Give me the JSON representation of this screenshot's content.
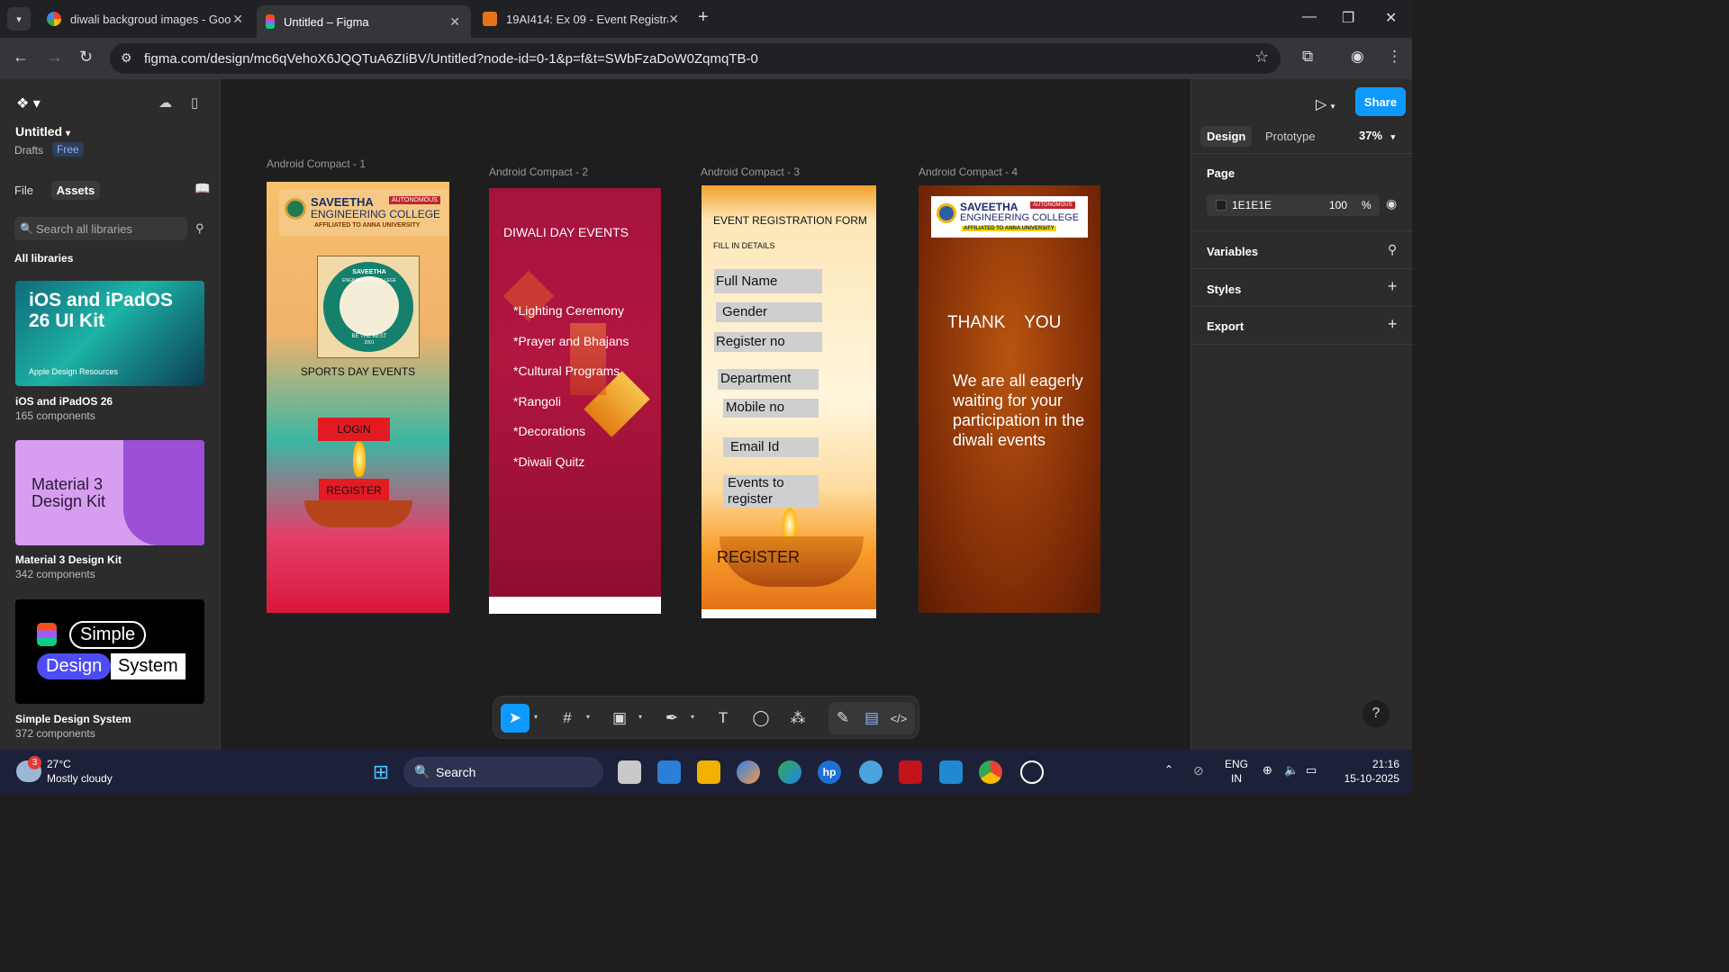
{
  "browser": {
    "tabs": [
      {
        "title": "diwali backgroud images - Goo",
        "active": false
      },
      {
        "title": "Untitled – Figma",
        "active": true
      },
      {
        "title": "19AI414: Ex 09 - Event Registrat",
        "active": false
      }
    ],
    "url": "figma.com/design/mc6qVehoX6JQQTuA6ZIiBV/Untitled?node-id=0-1&p=f&t=SWbFzaDoW0ZqmqTB-0"
  },
  "left_panel": {
    "file_title": "Untitled",
    "location": "Drafts",
    "plan_badge": "Free",
    "tabs": [
      "File",
      "Assets"
    ],
    "search_placeholder": "Search all libraries",
    "section_title": "All libraries",
    "libraries": [
      {
        "thumb_title": "iOS and iPadOS 26 UI Kit",
        "thumb_sub": "Apple Design Resources",
        "name": "iOS and iPadOS 26",
        "count": "165 components"
      },
      {
        "thumb_title": "Material 3 Design Kit",
        "name": "Material 3 Design Kit",
        "count": "342 components"
      },
      {
        "thumb_words": [
          "Simple",
          "Design",
          "System"
        ],
        "name": "Simple Design System",
        "count": "372 components"
      }
    ]
  },
  "canvas": {
    "frames": [
      {
        "label": "Android Compact - 1",
        "college_name": "SAVEETHA",
        "college_name2": "ENGINEERING COLLEGE",
        "autonomous": "AUTONOMOUS",
        "affiliated": "AFFILIATED TO ANNA UNIVERSITY",
        "seal_top": "SAVEETHA",
        "seal_mid": "ENGINEERING COLLEGE",
        "seal_motto": "BE THE BEST",
        "seal_year": "2001",
        "heading": "SPORTS  DAY  EVENTS",
        "login": "LOGIN",
        "register": "REGISTER"
      },
      {
        "label": "Android Compact - 2",
        "heading": "DIWALI   DAY  EVENTS",
        "items": [
          "*Lighting Ceremony",
          "*Prayer and Bhajans",
          "*Cultural Programs",
          "*Rangoli",
          "*Decorations",
          "*Diwali Quitz"
        ]
      },
      {
        "label": "Android Compact - 3",
        "heading": "EVENT  REGISTRATION  FORM",
        "sub": "FILL  IN  DETAILS",
        "fields": [
          "Full Name",
          "Gender",
          "Register no",
          "Department",
          "Mobile no",
          "Email Id",
          "Events to register"
        ],
        "register": "REGISTER"
      },
      {
        "label": "Android Compact - 4",
        "college_name": "SAVEETHA",
        "college_name2": "ENGINEERING COLLEGE",
        "autonomous": "AUTONOMOUS",
        "affiliated": "AFFILIATED TO ANNA UNIVERSITY",
        "thanks": "THANK    YOU",
        "message": "We are all eagerly  waiting for your participation in the diwali events"
      }
    ]
  },
  "right_panel": {
    "share": "Share",
    "tabs": [
      "Design",
      "Prototype"
    ],
    "zoom": "37%",
    "page_section": "Page",
    "page_color": "1E1E1E",
    "page_opacity": "100",
    "page_opacity_unit": "%",
    "sections": [
      "Variables",
      "Styles",
      "Export"
    ],
    "help": "?"
  },
  "taskbar": {
    "weather_temp": "27°C",
    "weather_desc": "Mostly cloudy",
    "weather_badge": "3",
    "search": "Search",
    "lang1": "ENG",
    "lang2": "IN",
    "time": "21:16",
    "date": "15-10-2025"
  },
  "colors": {
    "figma_blue": "#0d99ff",
    "canvas_bg": "#1e1e1e",
    "panel_bg": "#2c2c2c"
  }
}
